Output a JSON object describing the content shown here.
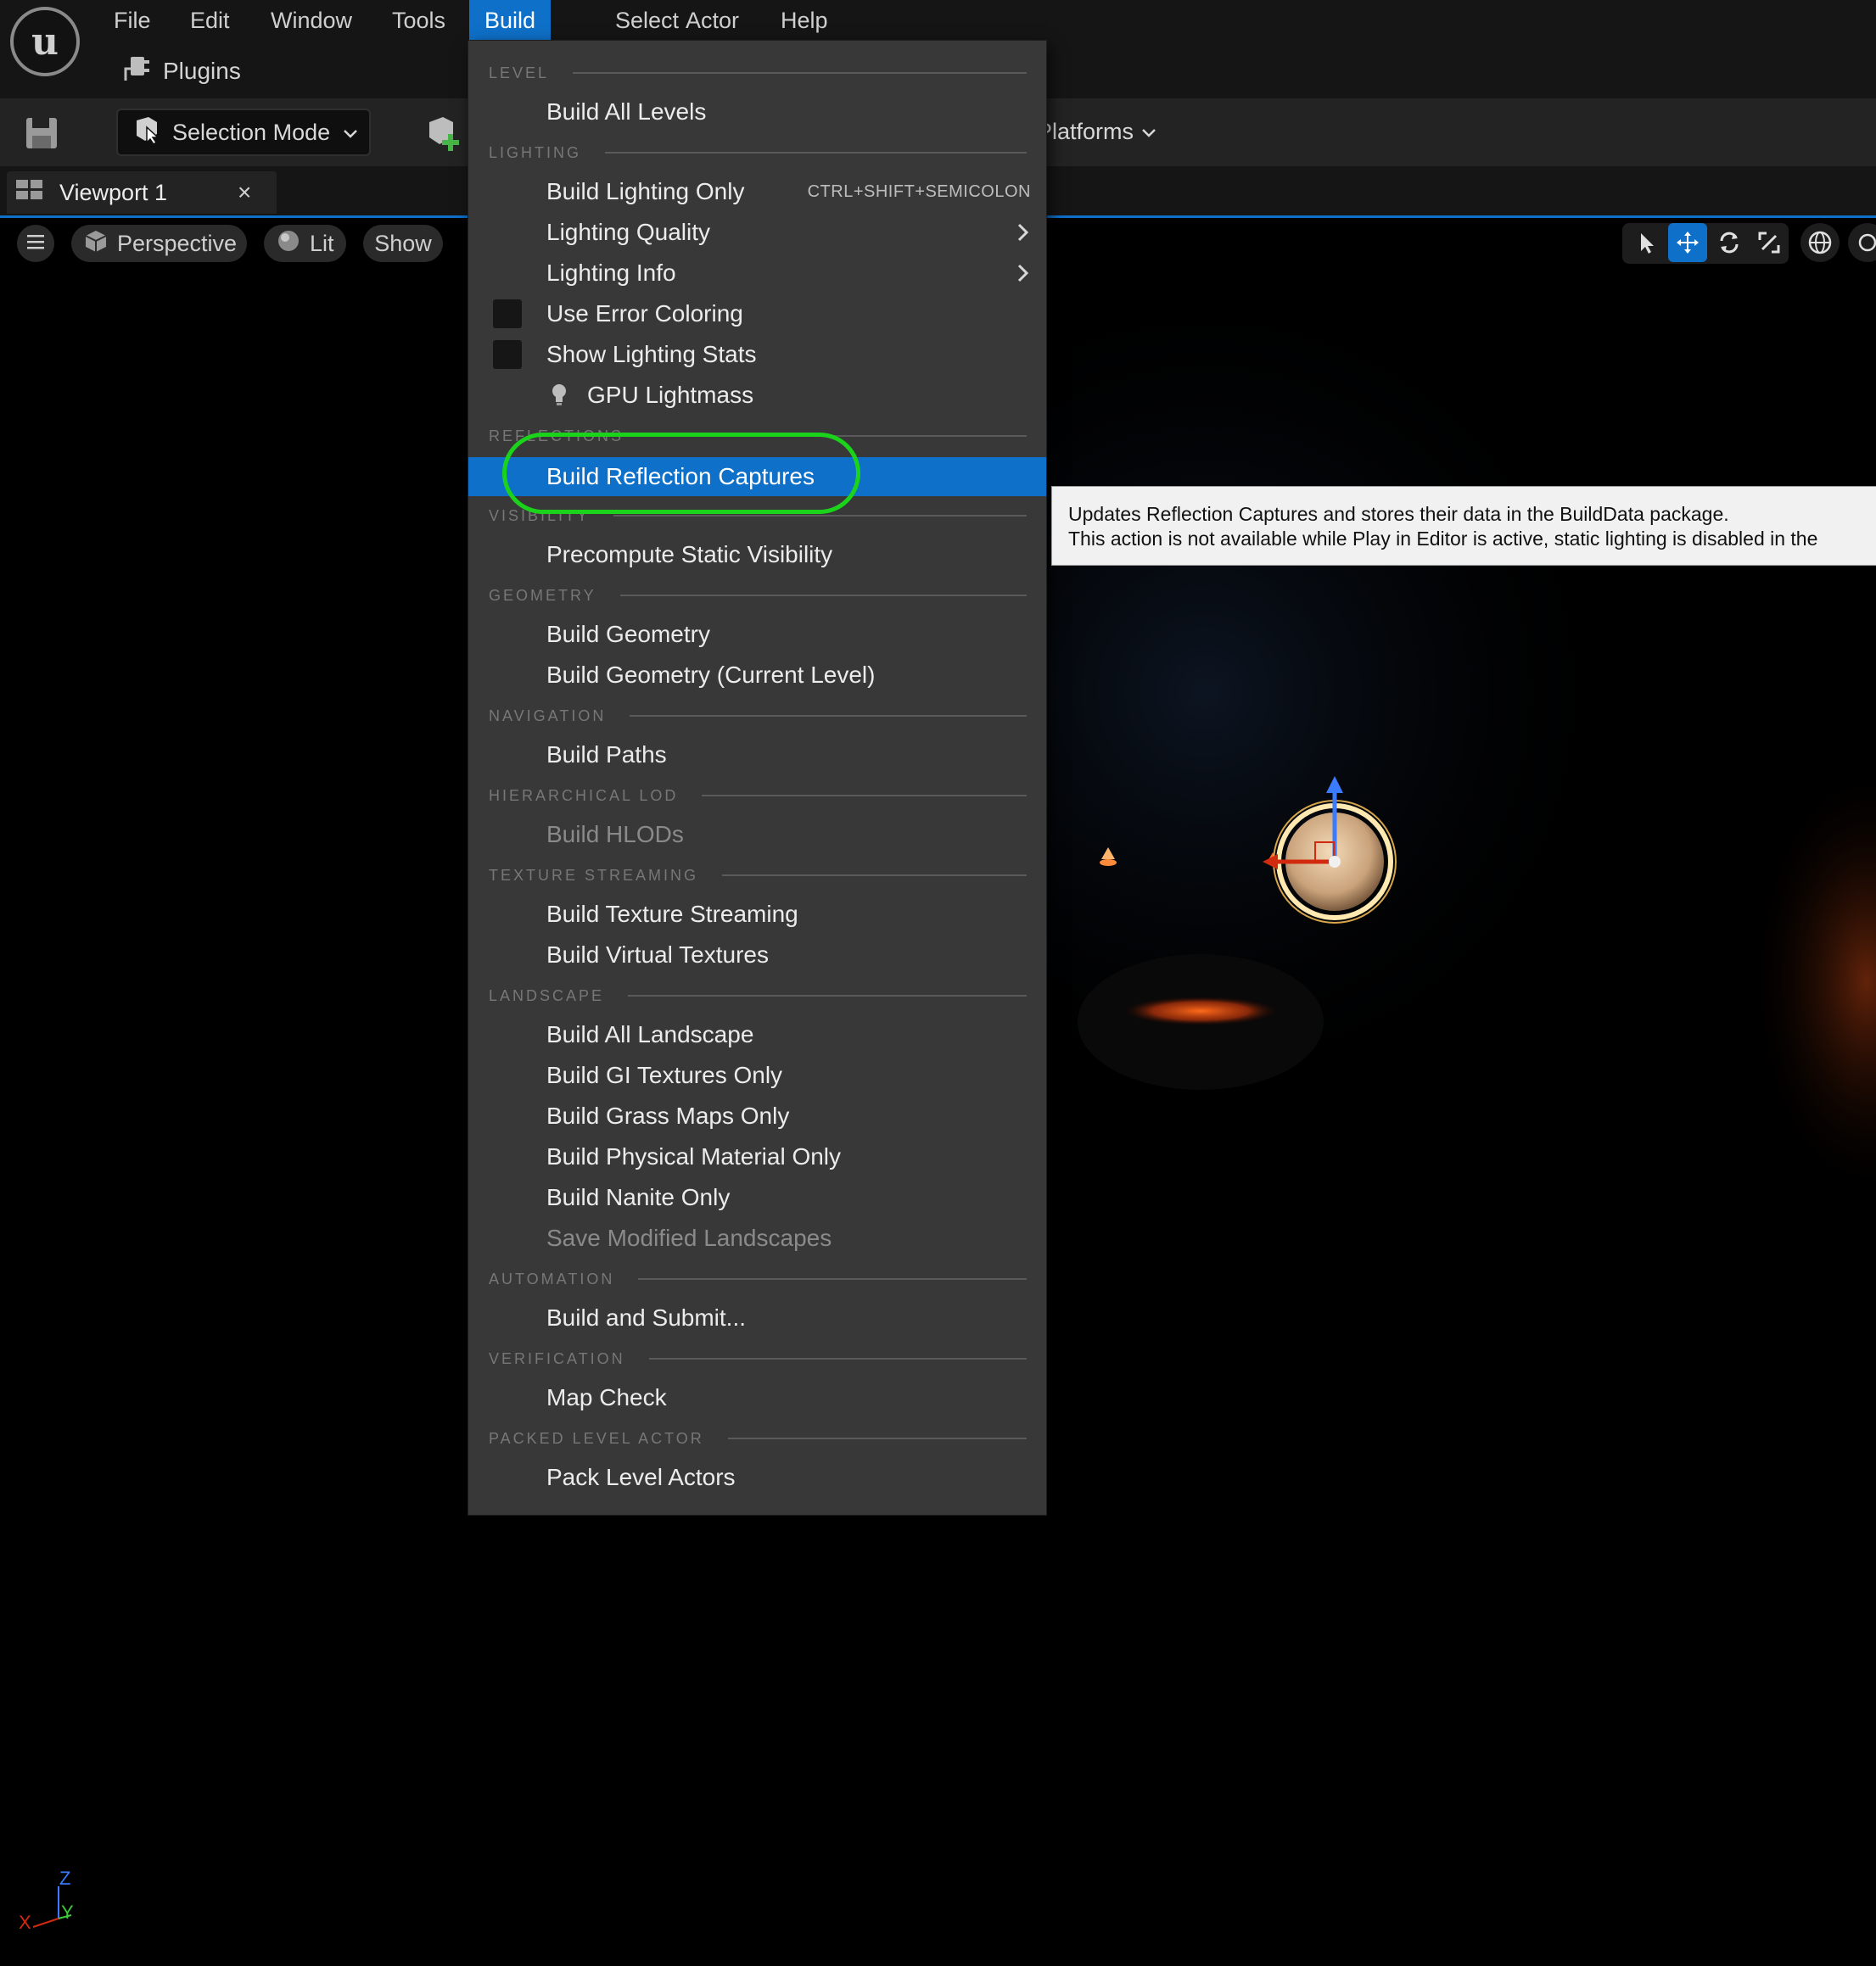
{
  "menubar": {
    "logo_letter": "u",
    "items": [
      "File",
      "Edit",
      "Window",
      "Tools",
      "Build",
      "Select",
      "Actor",
      "Help"
    ],
    "active": "Build",
    "plugins_label": "Plugins"
  },
  "toolbar": {
    "selection_mode": "Selection Mode",
    "platforms": "Platforms"
  },
  "tab": {
    "title": "Viewport 1",
    "close": "×"
  },
  "viewport_controls": {
    "perspective": "Perspective",
    "lit": "Lit",
    "show": "Show"
  },
  "axes": {
    "x": "X",
    "y": "Y",
    "z": "Z"
  },
  "build_menu": {
    "sections": {
      "level": "LEVEL",
      "lighting": "LIGHTING",
      "reflections": "REFLECTIONS",
      "visibility": "VISIBILITY",
      "geometry": "GEOMETRY",
      "navigation": "NAVIGATION",
      "hlod": "HIERARCHICAL LOD",
      "texture": "TEXTURE STREAMING",
      "landscape": "LANDSCAPE",
      "automation": "AUTOMATION",
      "verification": "VERIFICATION",
      "packed": "PACKED LEVEL ACTOR"
    },
    "items": {
      "build_all_levels": "Build All Levels",
      "build_lighting_only": "Build Lighting Only",
      "build_lighting_shortcut": "CTRL+SHIFT+SEMICOLON",
      "lighting_quality": "Lighting Quality",
      "lighting_info": "Lighting Info",
      "use_error_coloring": "Use Error Coloring",
      "show_lighting_stats": "Show Lighting Stats",
      "gpu_lightmass": "GPU Lightmass",
      "build_reflection_captures": "Build Reflection Captures",
      "precompute_static_visibility": "Precompute Static Visibility",
      "build_geometry": "Build Geometry",
      "build_geometry_current": "Build Geometry (Current Level)",
      "build_paths": "Build Paths",
      "build_hlods": "Build HLODs",
      "build_texture_streaming": "Build Texture Streaming",
      "build_virtual_textures": "Build Virtual Textures",
      "build_all_landscape": "Build All Landscape",
      "build_gi_textures_only": "Build GI Textures Only",
      "build_grass_maps_only": "Build Grass Maps Only",
      "build_physical_material_only": "Build Physical Material Only",
      "build_nanite_only": "Build Nanite Only",
      "save_modified_landscapes": "Save Modified Landscapes",
      "build_and_submit": "Build and Submit...",
      "map_check": "Map Check",
      "pack_level_actors": "Pack Level Actors"
    }
  },
  "tooltip": {
    "line1": "Updates Reflection Captures and stores their data in the BuildData package.",
    "line2": "This action is not available while Play in Editor is active, static lighting is disabled in the"
  },
  "colors": {
    "accent": "#0e70c8",
    "annotation": "#1cd31c",
    "menu_bg": "#383838"
  }
}
